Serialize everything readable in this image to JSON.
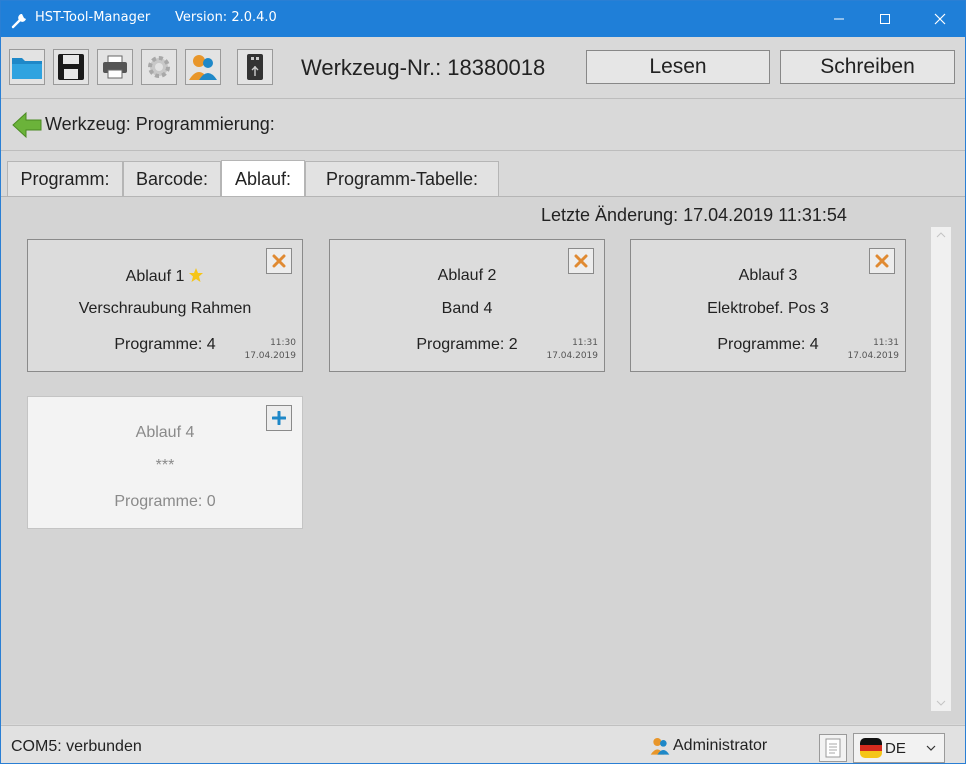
{
  "window": {
    "title": "HST-Tool-Manager",
    "version": "Version: 2.0.4.0",
    "accent_color": "#1f7fd8"
  },
  "toolbar": {
    "buttons": [
      {
        "name": "folder-icon"
      },
      {
        "name": "save-icon"
      },
      {
        "name": "printer-icon"
      },
      {
        "name": "gear-icon"
      },
      {
        "name": "user-icon"
      },
      {
        "name": "usb-icon"
      }
    ],
    "tool_label": "Werkzeug-Nr.: 18380018",
    "read_label": "Lesen",
    "write_label": "Schreiben"
  },
  "breadcrumb": {
    "title": "Werkzeug: Programmierung:"
  },
  "tabs": [
    {
      "label": "Programm:"
    },
    {
      "label": "Barcode:"
    },
    {
      "label": "Ablauf:",
      "active": true
    },
    {
      "label": "Programm-Tabelle:"
    }
  ],
  "content": {
    "last_change": "Letzte Änderung:  17.04.2019  11:31:54",
    "cards": [
      {
        "name": "Ablauf 1",
        "desc": "Verschraubung Rahmen",
        "programs": "Programme: 4",
        "time": "11:30",
        "date": "17.04.2019",
        "starred": true,
        "action": "delete"
      },
      {
        "name": "Ablauf 2",
        "desc": "Band 4",
        "programs": "Programme: 2",
        "time": "11:31",
        "date": "17.04.2019",
        "starred": false,
        "action": "delete"
      },
      {
        "name": "Ablauf 3",
        "desc": "Elektrobef. Pos 3",
        "programs": "Programme: 4",
        "time": "11:31",
        "date": "17.04.2019",
        "starred": false,
        "action": "delete"
      },
      {
        "name": "Ablauf 4",
        "desc": "***",
        "programs": "Programme: 0",
        "time": "",
        "date": "",
        "starred": false,
        "action": "add"
      }
    ]
  },
  "statusbar": {
    "connection": "COM5: verbunden",
    "user": "Administrator",
    "language": "DE"
  }
}
